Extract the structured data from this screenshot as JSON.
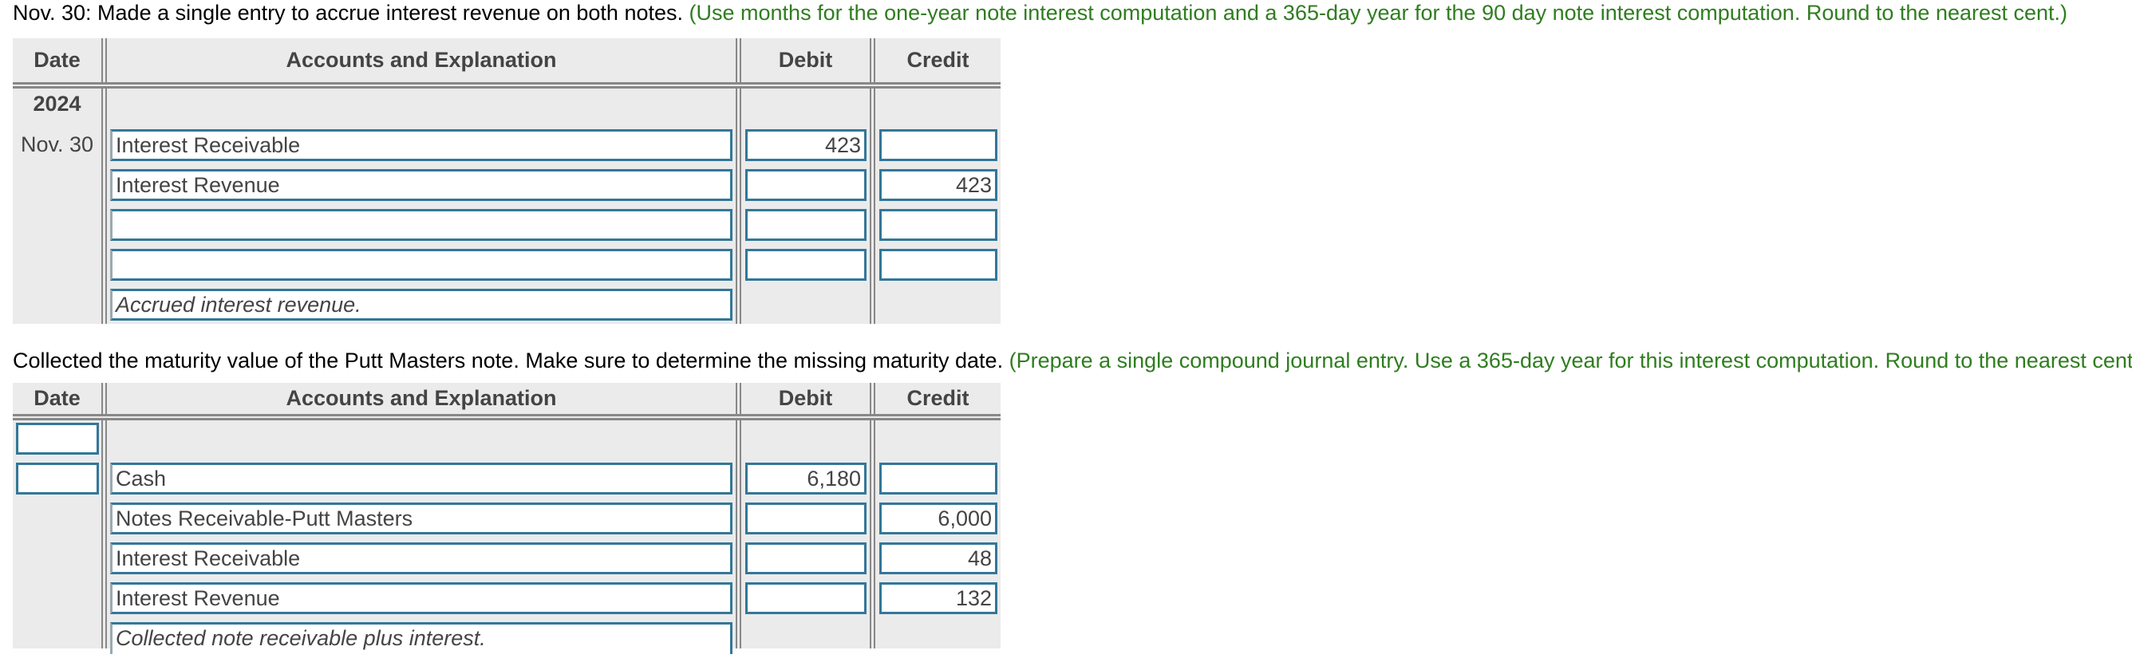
{
  "instructions": [
    {
      "text": "Nov. 30: Made a single entry to accrue interest revenue on both notes.",
      "hint": "(Use months for the one-year note interest computation and a 365-day year for the 90 day note interest computation. Round to the nearest cent.)"
    },
    {
      "text": "Collected the maturity value of the Putt Masters note. Make sure to determine the missing maturity date.",
      "hint": "(Prepare a single compound journal entry. Use a 365-day year for this interest computation. Round to the nearest cent.)"
    }
  ],
  "headers": {
    "date": "Date",
    "accounts": "Accounts and Explanation",
    "debit": "Debit",
    "credit": "Credit"
  },
  "colors": {
    "hint_green": "#2f7d1f",
    "input_border": "#337799",
    "table_bg": "#ebebeb",
    "divider": "#888888"
  },
  "journal1": {
    "year": "2024",
    "date": "Nov. 30",
    "rows": [
      {
        "account": "Interest Receivable",
        "debit": "423",
        "credit": ""
      },
      {
        "account": "Interest Revenue",
        "debit": "",
        "credit": "423"
      },
      {
        "account": "",
        "debit": "",
        "credit": ""
      },
      {
        "account": "",
        "debit": "",
        "credit": ""
      }
    ],
    "explanation": "Accrued interest revenue."
  },
  "journal2": {
    "month_input": "",
    "day_input": "",
    "rows": [
      {
        "account": "Cash",
        "debit": "6,180",
        "credit": ""
      },
      {
        "account": "Notes Receivable-Putt Masters",
        "debit": "",
        "credit": "6,000"
      },
      {
        "account": "Interest Receivable",
        "debit": "",
        "credit": "48"
      },
      {
        "account": "Interest Revenue",
        "debit": "",
        "credit": "132"
      }
    ],
    "explanation": "Collected note receivable plus interest."
  }
}
